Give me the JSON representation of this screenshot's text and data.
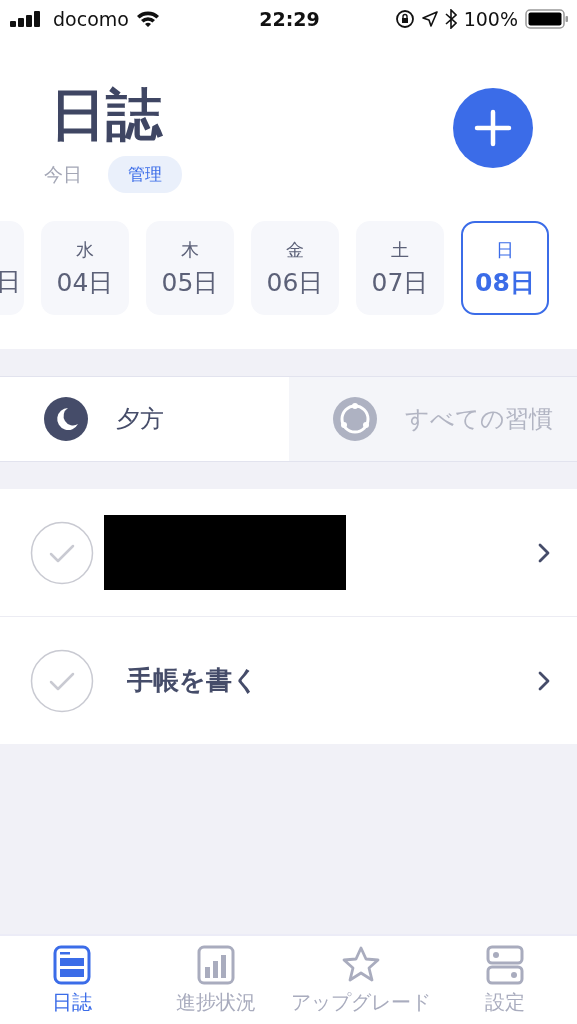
{
  "status_bar": {
    "carrier": "docomo",
    "time": "22:29",
    "battery": "100%"
  },
  "header": {
    "title": "日誌",
    "today": "今日",
    "manage": "管理"
  },
  "days": [
    {
      "date": "日",
      "selected": false
    },
    {
      "weekday": "水",
      "date": "04日",
      "selected": false
    },
    {
      "weekday": "木",
      "date": "05日",
      "selected": false
    },
    {
      "weekday": "金",
      "date": "06日",
      "selected": false
    },
    {
      "weekday": "土",
      "date": "07日",
      "selected": false
    },
    {
      "weekday": "日",
      "date": "08日",
      "selected": true
    }
  ],
  "segments": [
    {
      "label": "夕方",
      "kind": "moon",
      "selected": true
    },
    {
      "label": "すべての習慣",
      "kind": "ring",
      "selected": false
    }
  ],
  "habits": [
    {
      "kind": "redacted",
      "checked": false
    },
    {
      "kind": "text",
      "name": "手帳を書く",
      "checked": false
    }
  ],
  "tabs": [
    {
      "label": "日誌",
      "kind": "journal",
      "selected": true
    },
    {
      "label": "進捗状況",
      "kind": "chart",
      "selected": false
    },
    {
      "label": "アップグレード",
      "kind": "star",
      "selected": false
    },
    {
      "label": "設定",
      "kind": "toggles",
      "selected": false
    }
  ]
}
